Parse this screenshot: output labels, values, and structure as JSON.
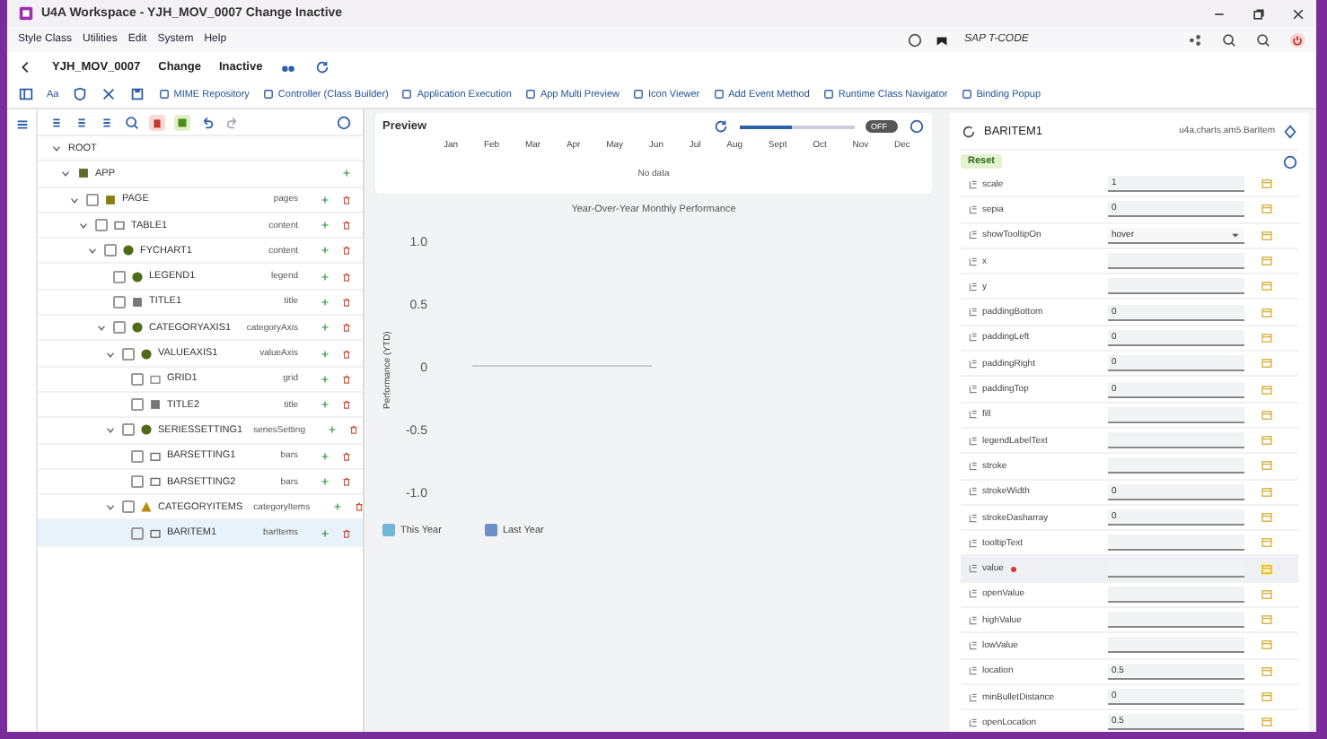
{
  "window": {
    "title": "U4A Workspace - YJH_MOV_0007 Change Inactive"
  },
  "menu": [
    "Style Class",
    "Utilities",
    "Edit",
    "System",
    "Help"
  ],
  "tcode": {
    "placeholder": "SAP T-CODE"
  },
  "header": {
    "app": "YJH_MOV_0007",
    "mode": "Change",
    "status": "Inactive"
  },
  "toolbar": {
    "text_button": "Aa",
    "buttons": [
      "MIME Repository",
      "Controller (Class Builder)",
      "Application Execution",
      "App Multi Preview",
      "Icon Viewer",
      "Add Event Method",
      "Runtime Class Navigator",
      "Binding Popup"
    ]
  },
  "tree": {
    "nodes": [
      {
        "name": "ROOT",
        "expanded": true,
        "children": [
          {
            "name": "APP",
            "kind": "app",
            "expanded": true,
            "children": [
              {
                "name": "PAGE",
                "kind": "page",
                "aggregation": "pages",
                "checked": false,
                "selected": false,
                "expanded": true,
                "children": [
                  {
                    "name": "TABLE1",
                    "kind": "folder",
                    "aggregation": "content",
                    "checked": false,
                    "selected": false,
                    "expanded": true,
                    "children": [
                      {
                        "name": "FYCHART1",
                        "kind": "chart",
                        "aggregation": "content",
                        "checked": false,
                        "selected": false,
                        "expanded": true,
                        "children": [
                          {
                            "name": "LEGEND1",
                            "kind": "chart",
                            "aggregation": "legend",
                            "checked": false,
                            "selected": false
                          },
                          {
                            "name": "TITLE1",
                            "kind": "text",
                            "aggregation": "title",
                            "checked": false,
                            "selected": false
                          },
                          {
                            "name": "CATEGORYAXIS1",
                            "kind": "chart",
                            "aggregation": "categoryAxis",
                            "checked": false,
                            "selected": false,
                            "expanded": true,
                            "children": [
                              {
                                "name": "VALUEAXIS1",
                                "kind": "chart",
                                "aggregation": "valueAxis",
                                "checked": false,
                                "selected": false,
                                "expanded": true,
                                "children": [
                                  {
                                    "name": "GRID1",
                                    "kind": "grid",
                                    "aggregation": "grid",
                                    "checked": false,
                                    "selected": false
                                  },
                                  {
                                    "name": "TITLE2",
                                    "kind": "text",
                                    "aggregation": "title",
                                    "checked": false,
                                    "selected": false
                                  }
                                ]
                              },
                              {
                                "name": "SERIESSETTING1",
                                "kind": "chart",
                                "aggregation": "seriesSetting",
                                "checked": false,
                                "selected": false,
                                "expanded": true,
                                "children": [
                                  {
                                    "name": "BARSETTING1",
                                    "kind": "folder",
                                    "aggregation": "bars",
                                    "checked": false,
                                    "selected": false
                                  },
                                  {
                                    "name": "BARSETTING2",
                                    "kind": "folder",
                                    "aggregation": "bars",
                                    "checked": false,
                                    "selected": false
                                  }
                                ]
                              },
                              {
                                "name": "CATEGORYITEMS",
                                "kind": "shapes",
                                "aggregation": "categoryItems",
                                "checked": false,
                                "selected": false,
                                "expanded": true,
                                "children": [
                                  {
                                    "name": "BARITEM1",
                                    "kind": "folder",
                                    "aggregation": "barItems",
                                    "checked": false,
                                    "selected": true
                                  }
                                ]
                              }
                            ]
                          }
                        ]
                      }
                    ]
                  }
                ]
              }
            ]
          }
        ]
      }
    ]
  },
  "preview": {
    "title": "Preview",
    "zoom": {
      "level": 0.45
    },
    "toggle": {
      "label": "OFF",
      "on": false
    },
    "months": [
      "Jan",
      "Feb",
      "Mar",
      "Apr",
      "May",
      "Jun",
      "Jul",
      "Aug",
      "Sept",
      "Oct",
      "Nov",
      "Dec"
    ],
    "empty": "No data",
    "chart_data": {
      "type": "bar",
      "title": "Year-Over-Year Monthly Performance",
      "ylabel": "Performance (YTD)",
      "ylim": [
        -1,
        1
      ],
      "yticks": [
        {
          "value": 1,
          "label": "1.0"
        },
        {
          "value": 0.5,
          "label": "0.5"
        },
        {
          "value": 0,
          "label": "0"
        },
        {
          "value": -0.5,
          "label": "-0.5"
        },
        {
          "value": -1,
          "label": "-1.0"
        }
      ],
      "series": [
        {
          "name": "This Year",
          "color": "#6fb6d9"
        },
        {
          "name": "Last Year",
          "color": "#6f8fc9"
        }
      ]
    }
  },
  "properties_panel": {
    "title": "BARITEM1",
    "class": "u4a.charts.am5.BarItem",
    "reset": "Reset",
    "properties": [
      {
        "name": "scale",
        "value": "1",
        "kind": "input",
        "required": false,
        "selected": false
      },
      {
        "name": "sepia",
        "value": "0",
        "kind": "input",
        "required": false,
        "selected": false
      },
      {
        "name": "showTooltipOn",
        "value": "hover",
        "kind": "select",
        "required": false,
        "selected": false
      },
      {
        "name": "x",
        "kind": "input",
        "required": false,
        "selected": false
      },
      {
        "name": "y",
        "kind": "input",
        "required": false,
        "selected": false
      },
      {
        "name": "paddingBottom",
        "value": "0",
        "kind": "input",
        "required": false,
        "selected": false
      },
      {
        "name": "paddingLeft",
        "value": "0",
        "kind": "input",
        "required": false,
        "selected": false
      },
      {
        "name": "paddingRight",
        "value": "0",
        "kind": "input",
        "required": false,
        "selected": false
      },
      {
        "name": "paddingTop",
        "value": "0",
        "kind": "input",
        "required": false,
        "selected": false
      },
      {
        "name": "fill",
        "kind": "input",
        "required": false,
        "selected": false
      },
      {
        "name": "legendLabelText",
        "kind": "input",
        "required": false,
        "selected": false
      },
      {
        "name": "stroke",
        "kind": "input",
        "required": false,
        "selected": false
      },
      {
        "name": "strokeWidth",
        "value": "0",
        "kind": "input",
        "required": false,
        "selected": false
      },
      {
        "name": "strokeDasharray",
        "value": "0",
        "kind": "input",
        "required": false,
        "selected": false
      },
      {
        "name": "tooltipText",
        "kind": "input",
        "required": false,
        "selected": false
      },
      {
        "name": "value",
        "kind": "input",
        "required": true,
        "selected": true
      },
      {
        "name": "openValue",
        "kind": "input",
        "required": false,
        "selected": false
      },
      {
        "name": "highValue",
        "kind": "input",
        "required": false,
        "selected": false
      },
      {
        "name": "lowValue",
        "kind": "input",
        "required": false,
        "selected": false
      },
      {
        "name": "location",
        "value": "0.5",
        "kind": "input",
        "required": false,
        "selected": false
      },
      {
        "name": "minBulletDistance",
        "value": "0",
        "kind": "input",
        "required": false,
        "selected": false
      },
      {
        "name": "openLocation",
        "value": "0.5",
        "kind": "input",
        "required": false,
        "selected": false
      }
    ]
  }
}
